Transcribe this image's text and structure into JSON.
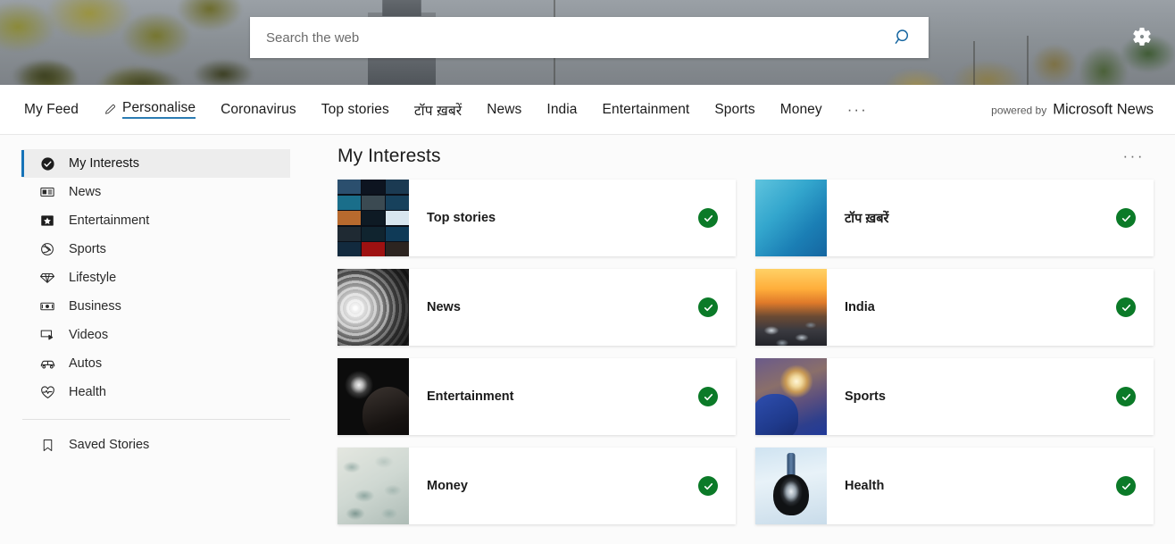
{
  "hero": {
    "search": {
      "placeholder": "Search the web",
      "value": "",
      "button_icon": "search-icon"
    },
    "settings_icon": "gear-icon"
  },
  "nav": {
    "items": [
      {
        "label": "My Feed",
        "active": false,
        "icon": null
      },
      {
        "label": "Personalise",
        "active": true,
        "icon": "pencil-icon"
      },
      {
        "label": "Coronavirus",
        "active": false,
        "icon": null
      },
      {
        "label": "Top stories",
        "active": false,
        "icon": null
      },
      {
        "label": "टॉप ख़बरें",
        "active": false,
        "icon": null
      },
      {
        "label": "News",
        "active": false,
        "icon": null
      },
      {
        "label": "India",
        "active": false,
        "icon": null
      },
      {
        "label": "Entertainment",
        "active": false,
        "icon": null
      },
      {
        "label": "Sports",
        "active": false,
        "icon": null
      },
      {
        "label": "Money",
        "active": false,
        "icon": null
      }
    ],
    "overflow_label": "···",
    "powered_by_prefix": "powered by",
    "powered_by_brand": "Microsoft News",
    "accent_color": "#2b7cb3"
  },
  "sidebar": {
    "items": [
      {
        "label": "My Interests",
        "icon": "check-circle-icon",
        "active": true
      },
      {
        "label": "News",
        "icon": "newspaper-icon",
        "active": false
      },
      {
        "label": "Entertainment",
        "icon": "star-box-icon",
        "active": false
      },
      {
        "label": "Sports",
        "icon": "ball-icon",
        "active": false
      },
      {
        "label": "Lifestyle",
        "icon": "diamond-icon",
        "active": false
      },
      {
        "label": "Business",
        "icon": "banknote-icon",
        "active": false
      },
      {
        "label": "Videos",
        "icon": "video-icon",
        "active": false
      },
      {
        "label": "Autos",
        "icon": "car-icon",
        "active": false
      },
      {
        "label": "Health",
        "icon": "heart-pulse-icon",
        "active": false
      }
    ],
    "saved": {
      "label": "Saved Stories",
      "icon": "bookmark-icon"
    },
    "active_accent_color": "#1673b8"
  },
  "main": {
    "title": "My Interests",
    "overflow_label": "···",
    "check_color": "#0b7a28",
    "cards": [
      {
        "label": "Top stories",
        "thumb": "tv-mosaic-thumbnail",
        "selected": true
      },
      {
        "label": "टॉप ख़बरें",
        "thumb": "blue-gradient-thumbnail",
        "selected": true
      },
      {
        "label": "News",
        "thumb": "newspaper-roll-thumbnail",
        "selected": true
      },
      {
        "label": "India",
        "thumb": "sunset-traffic-thumbnail",
        "selected": true
      },
      {
        "label": "Entertainment",
        "thumb": "camera-flash-thumbnail",
        "selected": true
      },
      {
        "label": "Sports",
        "thumb": "celebration-thumbnail",
        "selected": true
      },
      {
        "label": "Money",
        "thumb": "coins-thumbnail",
        "selected": true
      },
      {
        "label": "Health",
        "thumb": "stethoscope-thumbnail",
        "selected": true
      }
    ]
  },
  "mosaic_tiles": [
    "#2b4f6e",
    "#0d1420",
    "#1b3a52",
    "#1a6e8a",
    "#3b4a52",
    "#17415c",
    "#b86a2e",
    "#0e1a24",
    "#d8e6ef",
    "#1f2a33",
    "#10242f",
    "#0f3a57",
    "#122a3e",
    "#9e1111",
    "#2c2420"
  ]
}
